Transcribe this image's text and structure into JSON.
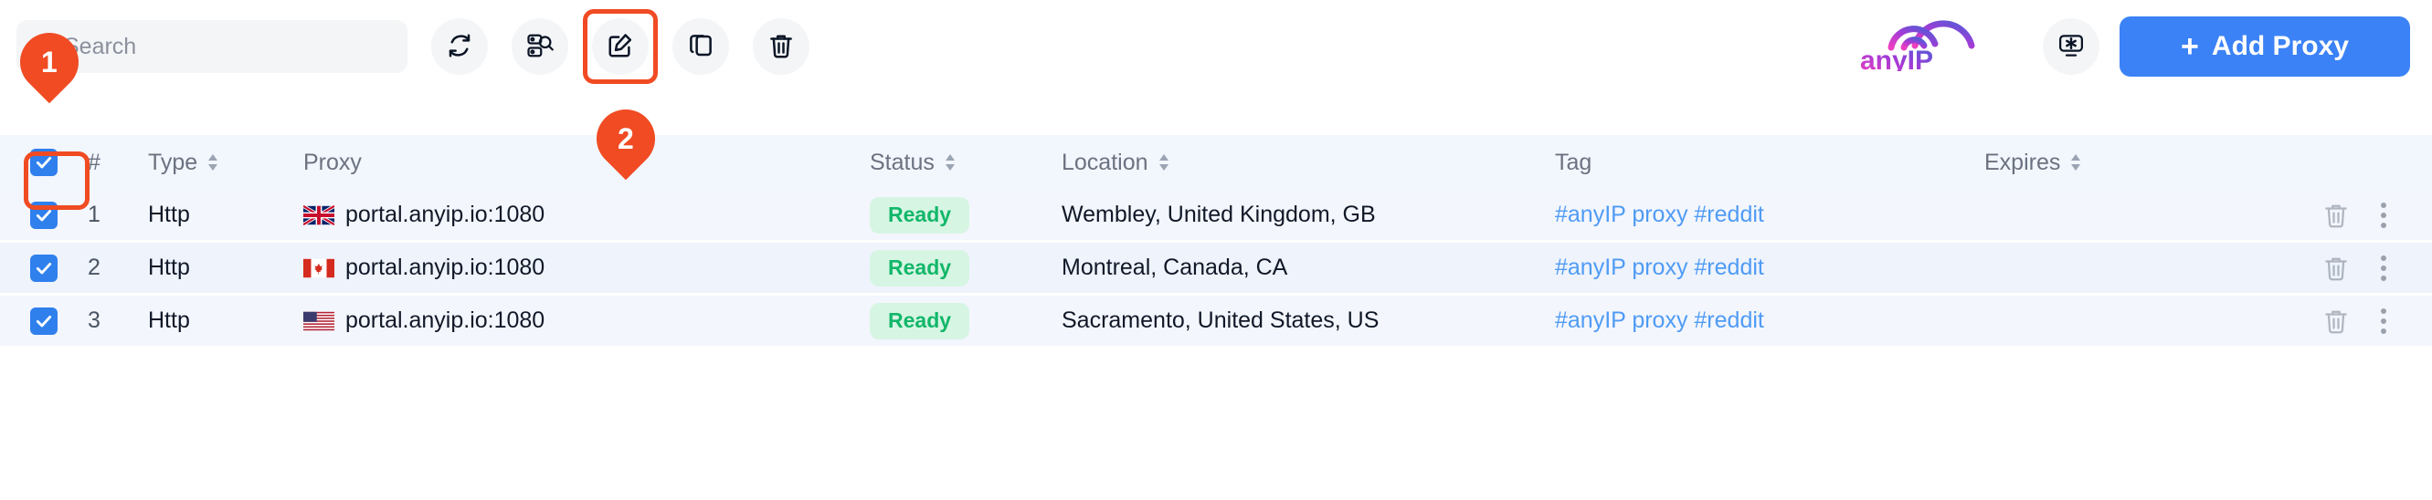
{
  "toolbar": {
    "search": {
      "placeholder": "Search",
      "value": ""
    },
    "buttons": [
      {
        "name": "refresh-button",
        "icon": "refresh-icon",
        "label": "Refresh"
      },
      {
        "name": "check-proxies-button",
        "icon": "proxy-check-icon",
        "label": "Check proxies"
      },
      {
        "name": "edit-button",
        "icon": "edit-pencil-icon",
        "label": "Edit"
      },
      {
        "name": "copy-button",
        "icon": "copy-icon",
        "label": "Copy"
      },
      {
        "name": "delete-button",
        "icon": "trash-icon",
        "label": "Delete"
      }
    ],
    "monitor_button": {
      "icon": "monitor-settings-icon",
      "label": "Monitor settings"
    },
    "add_proxy": {
      "plus": "+",
      "label": "Add Proxy"
    },
    "logo_text": "anyIP"
  },
  "annotations": [
    {
      "id": "1",
      "label": "1",
      "target": "select-all-checkbox"
    },
    {
      "id": "2",
      "label": "2",
      "target": "edit-button"
    }
  ],
  "table": {
    "columns": [
      {
        "key": "check",
        "label": "",
        "sortable": false
      },
      {
        "key": "num",
        "label": "#",
        "sortable": false
      },
      {
        "key": "type",
        "label": "Type",
        "sortable": true
      },
      {
        "key": "proxy",
        "label": "Proxy",
        "sortable": false
      },
      {
        "key": "status",
        "label": "Status",
        "sortable": true
      },
      {
        "key": "loc",
        "label": "Location",
        "sortable": true
      },
      {
        "key": "tag",
        "label": "Tag",
        "sortable": false
      },
      {
        "key": "exp",
        "label": "Expires",
        "sortable": true
      }
    ],
    "select_all_checked": true,
    "rows": [
      {
        "checked": true,
        "num": "1",
        "type": "Http",
        "flag": "gb",
        "proxy": "portal.anyip.io:1080",
        "status": "Ready",
        "location": "Wembley, United Kingdom, GB",
        "tag": "#anyIP proxy #reddit",
        "expires": ""
      },
      {
        "checked": true,
        "num": "2",
        "type": "Http",
        "flag": "ca",
        "proxy": "portal.anyip.io:1080",
        "status": "Ready",
        "location": "Montreal, Canada, CA",
        "tag": "#anyIP proxy #reddit",
        "expires": ""
      },
      {
        "checked": true,
        "num": "3",
        "type": "Http",
        "flag": "us",
        "proxy": "portal.anyip.io:1080",
        "status": "Ready",
        "location": "Sacramento, United States, US",
        "tag": "#anyIP proxy #reddit",
        "expires": ""
      }
    ],
    "row_actions": [
      {
        "name": "row-delete-icon",
        "icon": "trash-icon"
      },
      {
        "name": "row-menu-icon",
        "icon": "kebab-menu-icon"
      }
    ]
  },
  "colors": {
    "accent_blue": "#3b82f6",
    "checkbox_blue": "#2f80ed",
    "highlight_orange": "#f04b23",
    "status_green_text": "#12b76a",
    "status_green_bg": "#d7f5e3",
    "tag_blue": "#4f9bf5",
    "row_bg": "#f3f6fd",
    "header_bg": "#f2f6fd",
    "toolbar_field_bg": "#f4f5f7"
  }
}
